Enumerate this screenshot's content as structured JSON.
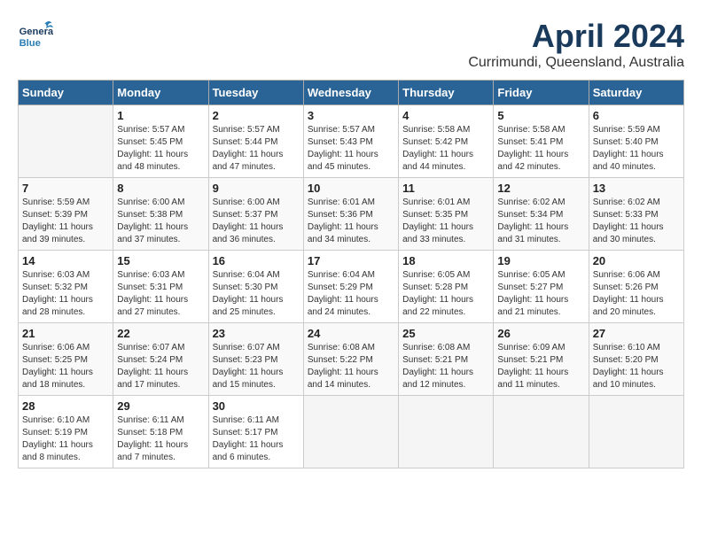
{
  "header": {
    "logo_general": "General",
    "logo_blue": "Blue",
    "month_year": "April 2024",
    "location": "Currimundi, Queensland, Australia"
  },
  "days_of_week": [
    "Sunday",
    "Monday",
    "Tuesday",
    "Wednesday",
    "Thursday",
    "Friday",
    "Saturday"
  ],
  "weeks": [
    [
      {
        "day": "",
        "sunrise": "",
        "sunset": "",
        "daylight": ""
      },
      {
        "day": "1",
        "sunrise": "Sunrise: 5:57 AM",
        "sunset": "Sunset: 5:45 PM",
        "daylight": "Daylight: 11 hours and 48 minutes."
      },
      {
        "day": "2",
        "sunrise": "Sunrise: 5:57 AM",
        "sunset": "Sunset: 5:44 PM",
        "daylight": "Daylight: 11 hours and 47 minutes."
      },
      {
        "day": "3",
        "sunrise": "Sunrise: 5:57 AM",
        "sunset": "Sunset: 5:43 PM",
        "daylight": "Daylight: 11 hours and 45 minutes."
      },
      {
        "day": "4",
        "sunrise": "Sunrise: 5:58 AM",
        "sunset": "Sunset: 5:42 PM",
        "daylight": "Daylight: 11 hours and 44 minutes."
      },
      {
        "day": "5",
        "sunrise": "Sunrise: 5:58 AM",
        "sunset": "Sunset: 5:41 PM",
        "daylight": "Daylight: 11 hours and 42 minutes."
      },
      {
        "day": "6",
        "sunrise": "Sunrise: 5:59 AM",
        "sunset": "Sunset: 5:40 PM",
        "daylight": "Daylight: 11 hours and 40 minutes."
      }
    ],
    [
      {
        "day": "7",
        "sunrise": "Sunrise: 5:59 AM",
        "sunset": "Sunset: 5:39 PM",
        "daylight": "Daylight: 11 hours and 39 minutes."
      },
      {
        "day": "8",
        "sunrise": "Sunrise: 6:00 AM",
        "sunset": "Sunset: 5:38 PM",
        "daylight": "Daylight: 11 hours and 37 minutes."
      },
      {
        "day": "9",
        "sunrise": "Sunrise: 6:00 AM",
        "sunset": "Sunset: 5:37 PM",
        "daylight": "Daylight: 11 hours and 36 minutes."
      },
      {
        "day": "10",
        "sunrise": "Sunrise: 6:01 AM",
        "sunset": "Sunset: 5:36 PM",
        "daylight": "Daylight: 11 hours and 34 minutes."
      },
      {
        "day": "11",
        "sunrise": "Sunrise: 6:01 AM",
        "sunset": "Sunset: 5:35 PM",
        "daylight": "Daylight: 11 hours and 33 minutes."
      },
      {
        "day": "12",
        "sunrise": "Sunrise: 6:02 AM",
        "sunset": "Sunset: 5:34 PM",
        "daylight": "Daylight: 11 hours and 31 minutes."
      },
      {
        "day": "13",
        "sunrise": "Sunrise: 6:02 AM",
        "sunset": "Sunset: 5:33 PM",
        "daylight": "Daylight: 11 hours and 30 minutes."
      }
    ],
    [
      {
        "day": "14",
        "sunrise": "Sunrise: 6:03 AM",
        "sunset": "Sunset: 5:32 PM",
        "daylight": "Daylight: 11 hours and 28 minutes."
      },
      {
        "day": "15",
        "sunrise": "Sunrise: 6:03 AM",
        "sunset": "Sunset: 5:31 PM",
        "daylight": "Daylight: 11 hours and 27 minutes."
      },
      {
        "day": "16",
        "sunrise": "Sunrise: 6:04 AM",
        "sunset": "Sunset: 5:30 PM",
        "daylight": "Daylight: 11 hours and 25 minutes."
      },
      {
        "day": "17",
        "sunrise": "Sunrise: 6:04 AM",
        "sunset": "Sunset: 5:29 PM",
        "daylight": "Daylight: 11 hours and 24 minutes."
      },
      {
        "day": "18",
        "sunrise": "Sunrise: 6:05 AM",
        "sunset": "Sunset: 5:28 PM",
        "daylight": "Daylight: 11 hours and 22 minutes."
      },
      {
        "day": "19",
        "sunrise": "Sunrise: 6:05 AM",
        "sunset": "Sunset: 5:27 PM",
        "daylight": "Daylight: 11 hours and 21 minutes."
      },
      {
        "day": "20",
        "sunrise": "Sunrise: 6:06 AM",
        "sunset": "Sunset: 5:26 PM",
        "daylight": "Daylight: 11 hours and 20 minutes."
      }
    ],
    [
      {
        "day": "21",
        "sunrise": "Sunrise: 6:06 AM",
        "sunset": "Sunset: 5:25 PM",
        "daylight": "Daylight: 11 hours and 18 minutes."
      },
      {
        "day": "22",
        "sunrise": "Sunrise: 6:07 AM",
        "sunset": "Sunset: 5:24 PM",
        "daylight": "Daylight: 11 hours and 17 minutes."
      },
      {
        "day": "23",
        "sunrise": "Sunrise: 6:07 AM",
        "sunset": "Sunset: 5:23 PM",
        "daylight": "Daylight: 11 hours and 15 minutes."
      },
      {
        "day": "24",
        "sunrise": "Sunrise: 6:08 AM",
        "sunset": "Sunset: 5:22 PM",
        "daylight": "Daylight: 11 hours and 14 minutes."
      },
      {
        "day": "25",
        "sunrise": "Sunrise: 6:08 AM",
        "sunset": "Sunset: 5:21 PM",
        "daylight": "Daylight: 11 hours and 12 minutes."
      },
      {
        "day": "26",
        "sunrise": "Sunrise: 6:09 AM",
        "sunset": "Sunset: 5:21 PM",
        "daylight": "Daylight: 11 hours and 11 minutes."
      },
      {
        "day": "27",
        "sunrise": "Sunrise: 6:10 AM",
        "sunset": "Sunset: 5:20 PM",
        "daylight": "Daylight: 11 hours and 10 minutes."
      }
    ],
    [
      {
        "day": "28",
        "sunrise": "Sunrise: 6:10 AM",
        "sunset": "Sunset: 5:19 PM",
        "daylight": "Daylight: 11 hours and 8 minutes."
      },
      {
        "day": "29",
        "sunrise": "Sunrise: 6:11 AM",
        "sunset": "Sunset: 5:18 PM",
        "daylight": "Daylight: 11 hours and 7 minutes."
      },
      {
        "day": "30",
        "sunrise": "Sunrise: 6:11 AM",
        "sunset": "Sunset: 5:17 PM",
        "daylight": "Daylight: 11 hours and 6 minutes."
      },
      {
        "day": "",
        "sunrise": "",
        "sunset": "",
        "daylight": ""
      },
      {
        "day": "",
        "sunrise": "",
        "sunset": "",
        "daylight": ""
      },
      {
        "day": "",
        "sunrise": "",
        "sunset": "",
        "daylight": ""
      },
      {
        "day": "",
        "sunrise": "",
        "sunset": "",
        "daylight": ""
      }
    ]
  ]
}
